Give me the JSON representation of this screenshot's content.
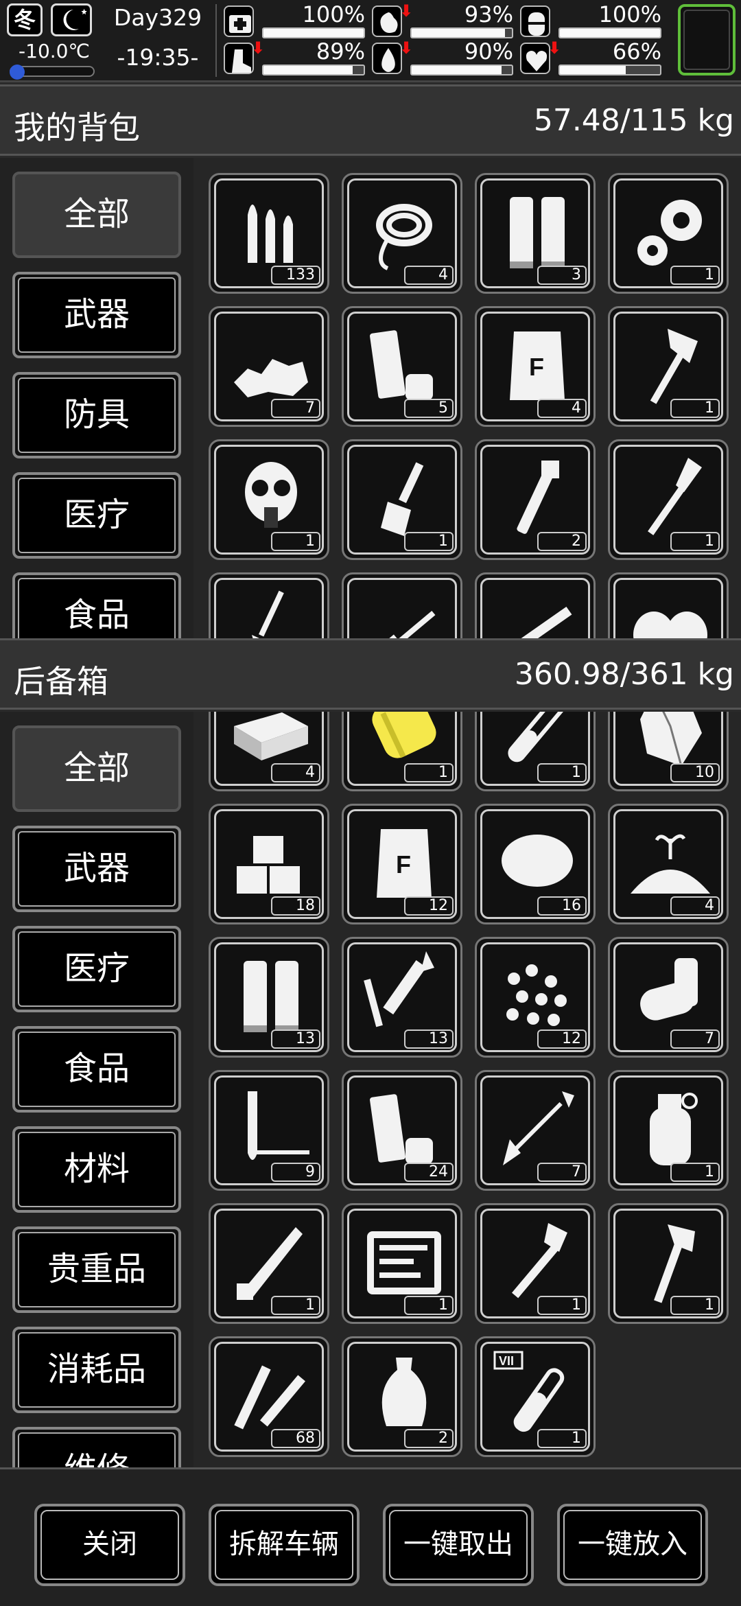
{
  "status": {
    "season": "冬",
    "temperature": "-10.0℃",
    "day": "Day329",
    "time": "-19:35-",
    "stats": [
      {
        "icon": "medkit-icon",
        "value": "100%",
        "level": 1.0,
        "decreasing": false
      },
      {
        "icon": "stomach-icon",
        "value": "93%",
        "level": 0.93,
        "decreasing": true
      },
      {
        "icon": "bladder-icon",
        "value": "100%",
        "level": 1.0,
        "decreasing": false
      },
      {
        "icon": "boot-icon",
        "value": "89%",
        "level": 0.89,
        "decreasing": true
      },
      {
        "icon": "water-drop-icon",
        "value": "90%",
        "level": 0.9,
        "decreasing": true
      },
      {
        "icon": "heart-icon",
        "value": "66%",
        "level": 0.66,
        "decreasing": true
      }
    ]
  },
  "backpack": {
    "title": "我的背包",
    "weight": "57.48/115 kg",
    "categories": [
      "全部",
      "武器",
      "防具",
      "医疗",
      "食品"
    ],
    "items": [
      {
        "icon": "bullets-icon",
        "count": "133"
      },
      {
        "icon": "rope-icon",
        "count": "4"
      },
      {
        "icon": "shells-icon",
        "count": "3"
      },
      {
        "icon": "gears-icon",
        "count": "1"
      },
      {
        "icon": "rubble-icon",
        "count": "7"
      },
      {
        "icon": "shotgun-shell-icon",
        "count": "5"
      },
      {
        "icon": "flour-sack-icon",
        "count": "4"
      },
      {
        "icon": "axe-icon",
        "count": "1"
      },
      {
        "icon": "gas-mask-icon",
        "count": "1"
      },
      {
        "icon": "chisel-icon",
        "count": "1"
      },
      {
        "icon": "pipe-wrench-icon",
        "count": "2"
      },
      {
        "icon": "spear-icon",
        "count": "1"
      },
      {
        "icon": "shovel-icon",
        "count": ""
      },
      {
        "icon": "rifle-icon",
        "count": ""
      },
      {
        "icon": "blade-icon",
        "count": ""
      },
      {
        "icon": "armor-icon",
        "count": ""
      }
    ]
  },
  "storage": {
    "title": "后备箱",
    "weight": "360.98/361 kg",
    "categories": [
      "全部",
      "武器",
      "医疗",
      "食品",
      "材料",
      "贵重品",
      "消耗品",
      "维修"
    ],
    "items": [
      {
        "icon": "metal-ingot-icon",
        "count": "4"
      },
      {
        "icon": "yellow-canister-icon",
        "count": "1"
      },
      {
        "icon": "test-tube-icon",
        "count": "1"
      },
      {
        "icon": "crystal-icon",
        "count": "10"
      },
      {
        "icon": "wood-blocks-icon",
        "count": "18"
      },
      {
        "icon": "flour-sack-icon",
        "count": "12"
      },
      {
        "icon": "cotton-icon",
        "count": "16"
      },
      {
        "icon": "soil-icon",
        "count": "4"
      },
      {
        "icon": "shells-icon",
        "count": "13"
      },
      {
        "icon": "rocket-icon",
        "count": "13"
      },
      {
        "icon": "pellets-icon",
        "count": "12"
      },
      {
        "icon": "pipes-icon",
        "count": "7"
      },
      {
        "icon": "arrowhead-icon",
        "count": "9"
      },
      {
        "icon": "shotgun-shell-icon",
        "count": "24"
      },
      {
        "icon": "arrow-icon",
        "count": "7"
      },
      {
        "icon": "grenade-icon",
        "count": "1"
      },
      {
        "icon": "machete-icon",
        "count": "1"
      },
      {
        "icon": "toolkit-icon",
        "count": "1"
      },
      {
        "icon": "rpg-icon",
        "count": "1"
      },
      {
        "icon": "hatchet-icon",
        "count": "1"
      },
      {
        "icon": "rifle-rounds-icon",
        "count": "68"
      },
      {
        "icon": "vase-icon",
        "count": "2"
      },
      {
        "icon": "vial-icon",
        "count": "1",
        "tag": "VII"
      }
    ]
  },
  "footer": {
    "close": "关闭",
    "dismantle": "拆解车辆",
    "take_all": "一键取出",
    "store_all": "一键放入"
  }
}
